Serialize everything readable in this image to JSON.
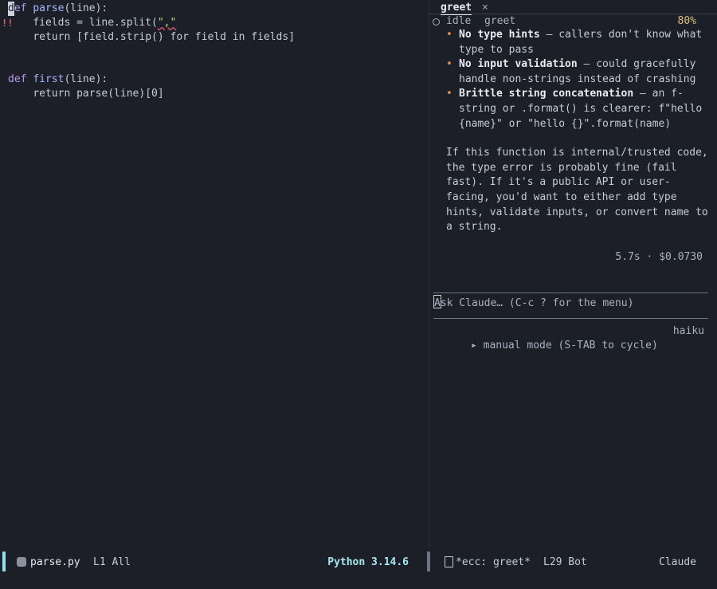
{
  "editor": {
    "lines": [
      {
        "kw": "def",
        "fn": "parse",
        "rest": "(line):"
      },
      {
        "indent": "    ",
        "pre": "fields = line.split(",
        "str": "\",\"",
        "post": ""
      },
      {
        "indent": "    ",
        "text": "return [field.strip() for field in fields]"
      },
      {
        "text": ""
      },
      {
        "text": ""
      },
      {
        "kw": "def",
        "fn": "first",
        "rest": "(line):"
      },
      {
        "indent": "    ",
        "text": "return parse(line)[0]"
      }
    ],
    "error_marker": "!!"
  },
  "side": {
    "tab_label": "greet",
    "tab_close": "×",
    "status": "idle",
    "session_name": "greet",
    "context_pct": "80%",
    "bullets": [
      {
        "bold": "No type hints",
        "text": " — callers don't know what type to pass"
      },
      {
        "bold": "No input validation",
        "text": " — could gracefully handle non-strings instead of crashing"
      },
      {
        "bold": "Brittle string concatenation",
        "text": " — an f-string or .format() is clearer: f\"hello {name}\" or \"hello {}\".format(name)"
      }
    ],
    "paragraph": "If this function is internal/trusted code, the type error is probably fine (fail fast). If it's a public API or user-facing, you'd want to either add type hints, validate inputs, or convert name to a string.",
    "meta": "5.7s · $0.0730",
    "prompt_placeholder": "Ask Claude… (C-c ? for the menu)",
    "mode_text": "▸ manual mode (S-TAB to cycle)",
    "model": "haiku"
  },
  "modeline_left": {
    "filename": "parse.py",
    "position": "L1 All",
    "language": "Python 3.14.6"
  },
  "modeline_right": {
    "buffer": "*ecc: greet*",
    "position": "L29 Bot",
    "mode": "Claude"
  }
}
